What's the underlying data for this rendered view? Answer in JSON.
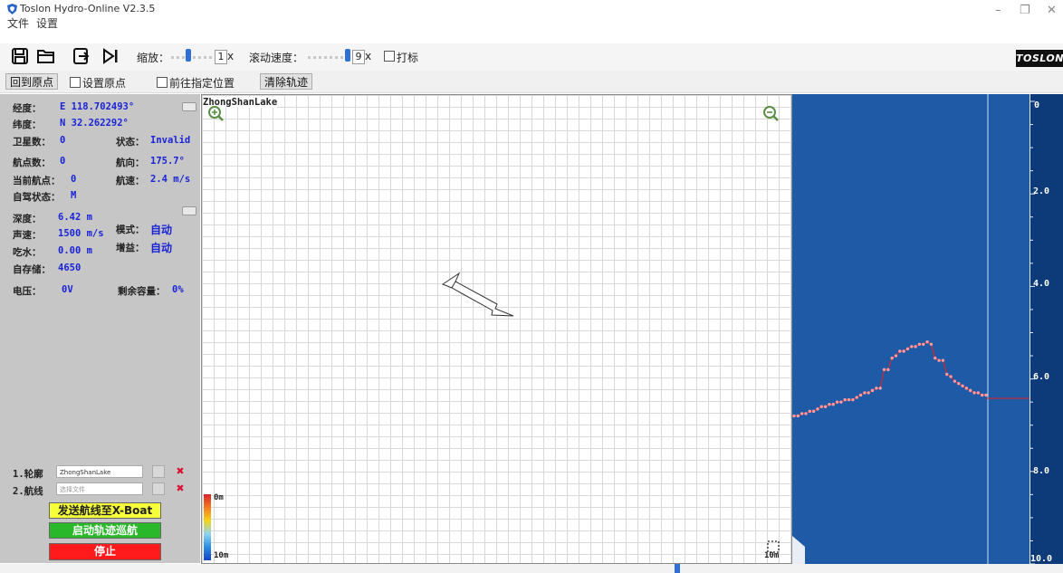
{
  "window": {
    "title": "Toslon Hydro-Online V2.3.5",
    "menu": [
      "文件",
      "设置"
    ],
    "controls": [
      "–",
      "❐",
      "✕"
    ]
  },
  "toolbar": {
    "zoom_label": "缩放：",
    "zoom_value": "1",
    "zoom_unit": "x",
    "scroll_label": "滚动速度：",
    "scroll_value": "9",
    "scroll_unit": "x",
    "mark_label": "打标",
    "brand": "TOSLON",
    "icons": [
      "save-icon",
      "open-folder-icon",
      "export-icon",
      "play-step-icon"
    ]
  },
  "toolbar2": {
    "return_origin": "回到原点",
    "set_origin": "设置原点",
    "goto_position": "前往指定位置",
    "clear_track": "清除轨迹"
  },
  "status": {
    "lon_label": "经度：",
    "lon_value": "E 118.702493°",
    "lat_label": "纬度：",
    "lat_value": "N 32.262292°",
    "sats_label": "卫星数：",
    "sats_value": "0",
    "state_label": "状态：",
    "state_value": "Invalid",
    "waypoints_label": "航点数：",
    "waypoints_value": "0",
    "heading_label": "航向：",
    "heading_value": "175.7°",
    "current_wp_label": "当前航点：",
    "current_wp_value": "0",
    "speed_label": "航速：",
    "speed_value": "2.4 m/s",
    "autopilot_label": "自驾状态：",
    "autopilot_value": "M",
    "depth_label": "深度：",
    "depth_value": "6.42 m",
    "sound_label": "声速：",
    "sound_value": "1500 m/s",
    "draft_label": "吃水：",
    "draft_value": "0.00 m",
    "mode_label": "模式：",
    "mode_value": "自动",
    "gain_label": "增益：",
    "gain_value": "自动",
    "storage_label": "自存储：",
    "storage_value": "4650",
    "voltage_label": "电压：",
    "voltage_value": "0V",
    "capacity_label": "剩余容量：",
    "capacity_value": "0%"
  },
  "files": {
    "outline_label": "1.轮廓",
    "outline_value": "ZhongShanLake",
    "route_label": "2.航线",
    "route_placeholder": "选择文件"
  },
  "actions": {
    "send_route": "发送航线至X-Boat",
    "start_track": "启动轨迹巡航",
    "stop": "停止"
  },
  "map": {
    "name": "ZhongShanLake",
    "legend_top": "0m",
    "legend_bottom": "10m",
    "scale_label": "10m"
  },
  "sonar": {
    "scale_labels": [
      "0",
      "2.0",
      "4.0",
      "6.0",
      "8.0",
      "10.0"
    ],
    "depth_max": 10,
    "profile_depths": [
      6.8,
      6.8,
      6.75,
      6.75,
      6.7,
      6.7,
      6.65,
      6.6,
      6.6,
      6.55,
      6.55,
      6.5,
      6.5,
      6.45,
      6.45,
      6.45,
      6.4,
      6.35,
      6.3,
      6.3,
      6.25,
      6.2,
      6.2,
      5.8,
      5.8,
      5.55,
      5.5,
      5.4,
      5.4,
      5.35,
      5.3,
      5.3,
      5.25,
      5.25,
      5.2,
      5.25,
      5.55,
      5.6,
      5.6,
      5.9,
      5.95,
      6.05,
      6.1,
      6.15,
      6.2,
      6.25,
      6.3,
      6.3,
      6.35,
      6.35
    ],
    "flat_depth": 6.42,
    "colors": {
      "profile": "#d2282e",
      "background": "#1f5aa6",
      "scale_bg": "#0d3a78"
    }
  }
}
